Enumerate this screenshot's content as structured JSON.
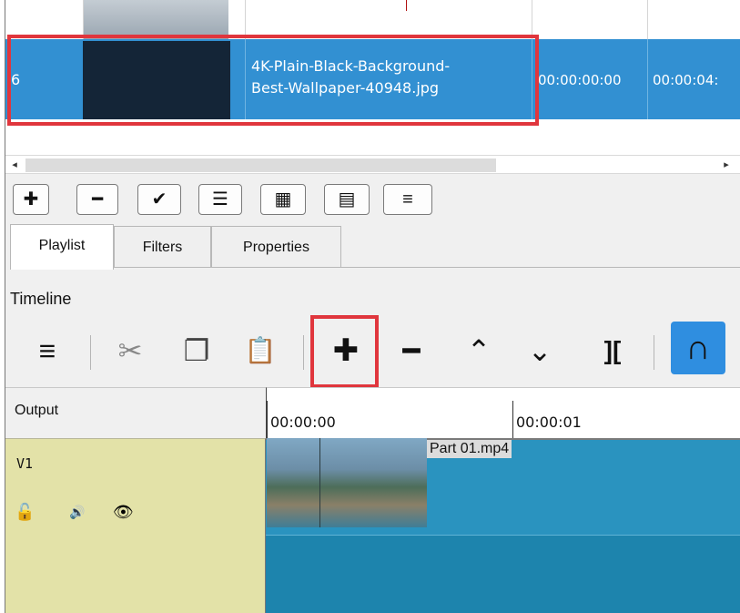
{
  "playlist": {
    "selected_row": {
      "index": "6",
      "filename_line1": "4K-Plain-Black-Background-",
      "filename_line2": "Best-Wallpaper-40948.jpg",
      "in": "00:00:00:00",
      "duration": "00:00:04:"
    },
    "toolbar": {
      "add": "✚",
      "remove": "━",
      "update": "✔",
      "details_view": "☰",
      "tiles_view": "▦",
      "icons_view": "▤",
      "menu": "≡"
    },
    "tabs": [
      {
        "label": "Playlist"
      },
      {
        "label": "Filters"
      },
      {
        "label": "Properties"
      }
    ]
  },
  "timeline": {
    "title": "Timeline",
    "toolbar": {
      "menu": "≡",
      "cut": "✂",
      "copy": "❐",
      "paste": "📋",
      "append": "✚",
      "remove": "━",
      "lift": "⌃",
      "overwrite": "⌄",
      "split": "]["
    },
    "output_label": "Output",
    "ruler": [
      "00:00:00",
      "00:00:01"
    ],
    "track": {
      "name": "V1",
      "lock_icon": "🔓",
      "mute_icon": "🔊",
      "eye_icon": "👁"
    },
    "clip": {
      "label": "Part 01.mp4"
    }
  },
  "colors": {
    "selection": "#3290d2",
    "highlight": "#e0363d",
    "track_head": "#e3e2a8",
    "clip": "#2a93bf",
    "snap_active": "#2f8ee0"
  }
}
